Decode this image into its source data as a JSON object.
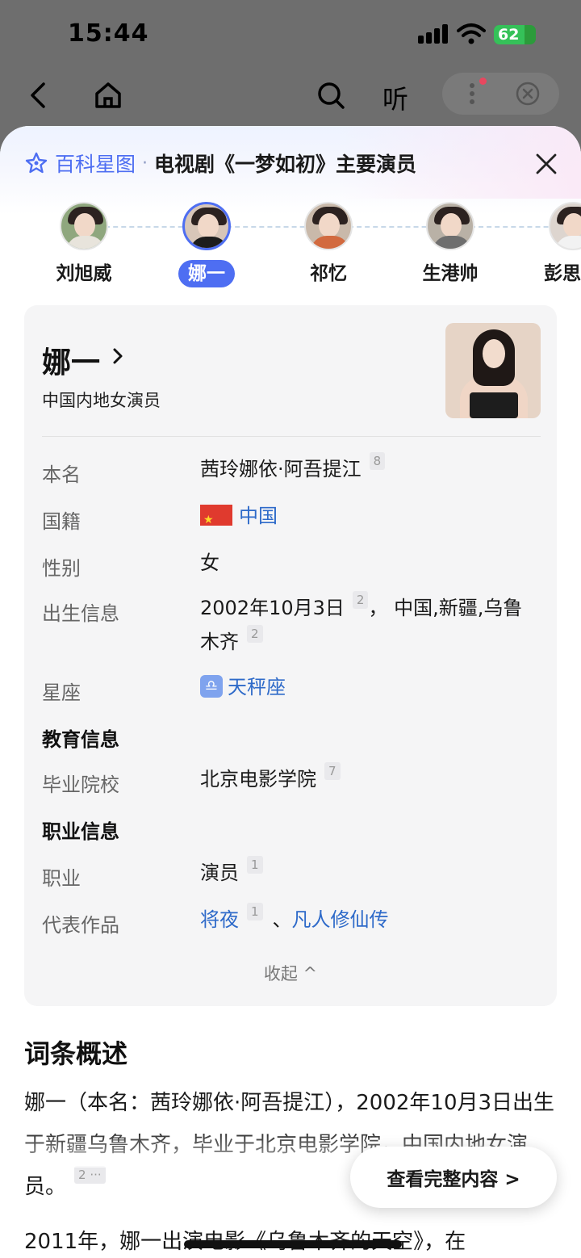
{
  "status_bar": {
    "time": "15:44",
    "battery": "62"
  },
  "navbar": {
    "listen_label": "听"
  },
  "header": {
    "brand": "百科星图",
    "separator": "·",
    "title": "电视剧《一梦如初》主要演员"
  },
  "cast": [
    {
      "name": "刘旭威"
    },
    {
      "name": "娜一"
    },
    {
      "name": "祁忆"
    },
    {
      "name": "生港帅"
    },
    {
      "name": "彭思"
    }
  ],
  "card": {
    "name": "娜一",
    "subtitle": "中国内地女演员",
    "real_name_label": "本名",
    "real_name": "茜玲娜依·阿吾提江",
    "real_name_ref": "8",
    "nationality_label": "国籍",
    "nationality": "中国",
    "gender_label": "性别",
    "gender": "女",
    "birth_label": "出生信息",
    "birth_date": "2002年10月3日",
    "birth_ref1": "2",
    "birth_place": "，  中国,新疆,乌鲁木齐",
    "birth_ref2": "2",
    "zodiac_label": "星座",
    "zodiac_symbol": "♎",
    "zodiac": "天秤座",
    "education_section": "教育信息",
    "school_label": "毕业院校",
    "school": "北京电影学院",
    "school_ref": "7",
    "career_section": "职业信息",
    "job_label": "职业",
    "job": "演员",
    "job_ref": "1",
    "works_label": "代表作品",
    "work1": "将夜",
    "work1_ref": "1",
    "work_sep": "、",
    "work2": "凡人修仙传",
    "collapse": "收起 ^"
  },
  "summary": {
    "title": "词条概述",
    "text": "娜一（本名：茜玲娜依·阿吾提江），2002年10月3日出生于新疆乌鲁木齐，毕业于北京电影学院，中国内地女演员。",
    "ref": "2 ···",
    "text2": "2011年，娜一出演电影《乌鲁木齐的天空》，在"
  },
  "view_full_button": "查看完整内容 >"
}
